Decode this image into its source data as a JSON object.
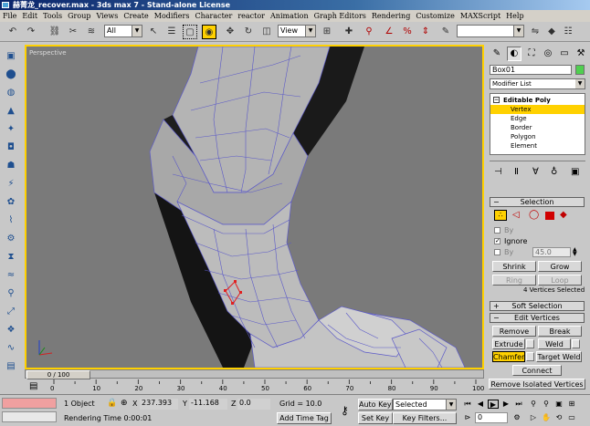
{
  "window": {
    "title": "赫菁龙_recover.max - 3ds max 7  - Stand-alone License"
  },
  "menu": {
    "items": [
      "File",
      "Edit",
      "Tools",
      "Group",
      "Views",
      "Create",
      "Modifiers",
      "Character",
      "reactor",
      "Animation",
      "Graph Editors",
      "Rendering",
      "Customize",
      "MAXScript",
      "Help"
    ]
  },
  "toolbar": {
    "selection_filter": "All",
    "reference_coord": "View",
    "icons": [
      "undo-icon",
      "redo-icon",
      "select-link-icon",
      "unlink-icon",
      "bind-space-warp-icon",
      "select-object-icon",
      "select-by-name-icon",
      "rect-select-region-icon",
      "window-crossing-icon",
      "select-move-icon",
      "select-rotate-icon",
      "select-scale-icon",
      "pivot-icon",
      "manipulate-icon",
      "snap-icon",
      "angle-snap-icon",
      "percent-snap-icon",
      "spinner-snap-icon",
      "named-selection-icon",
      "mirror-icon",
      "align-icon",
      "curve-editor-icon",
      "material-editor-icon",
      "render-scene-icon",
      "quick-render-icon"
    ]
  },
  "viewport": {
    "label": "Perspective"
  },
  "command_panel": {
    "object_name": "Box01",
    "object_color": "#4fcf4f",
    "modifier_list": "Modifier List",
    "stack": {
      "root": "Editable Poly",
      "items": [
        "Vertex",
        "Edge",
        "Border",
        "Polygon",
        "Element"
      ],
      "selected": "Vertex"
    },
    "selection_rollout": {
      "title": "Selection",
      "by_vertex_label": "By",
      "ignore_label": "Ignore",
      "by_angle_label": "By",
      "angle_value": "45.0",
      "shrink": "Shrink",
      "grow": "Grow",
      "ring": "Ring",
      "loop": "Loop",
      "status": "4 Vertices Selected"
    },
    "soft_selection": "Soft Selection",
    "edit_vertices": {
      "title": "Edit Vertices",
      "remove": "Remove",
      "break": "Break",
      "extrude": "Extrude",
      "weld": "Weld",
      "chamfer": "Chamfer",
      "target_weld": "Target Weld",
      "connect": "Connect",
      "remove_isolated": "Remove Isolated Vertices"
    },
    "accent": "#ffd100"
  },
  "timeline": {
    "frame_display": "0 / 100",
    "ticks": [
      "0",
      "10",
      "20",
      "30",
      "40",
      "50",
      "60",
      "70",
      "80",
      "90",
      "100"
    ]
  },
  "status": {
    "selection_info": "1 Object",
    "x_label": "X",
    "x_value": "237.393",
    "y_label": "Y",
    "y_value": "-11.168",
    "z_label": "Z",
    "z_value": "0.0",
    "grid": "Grid = 10.0",
    "rendering_time": "Rendering Time  0:00:01",
    "add_time_tag": "Add Time Tag",
    "auto_key": "Auto Key",
    "set_key": "Set Key",
    "key_filters": "Key Filters...",
    "selected_option": "Selected",
    "frame_value": "0"
  }
}
